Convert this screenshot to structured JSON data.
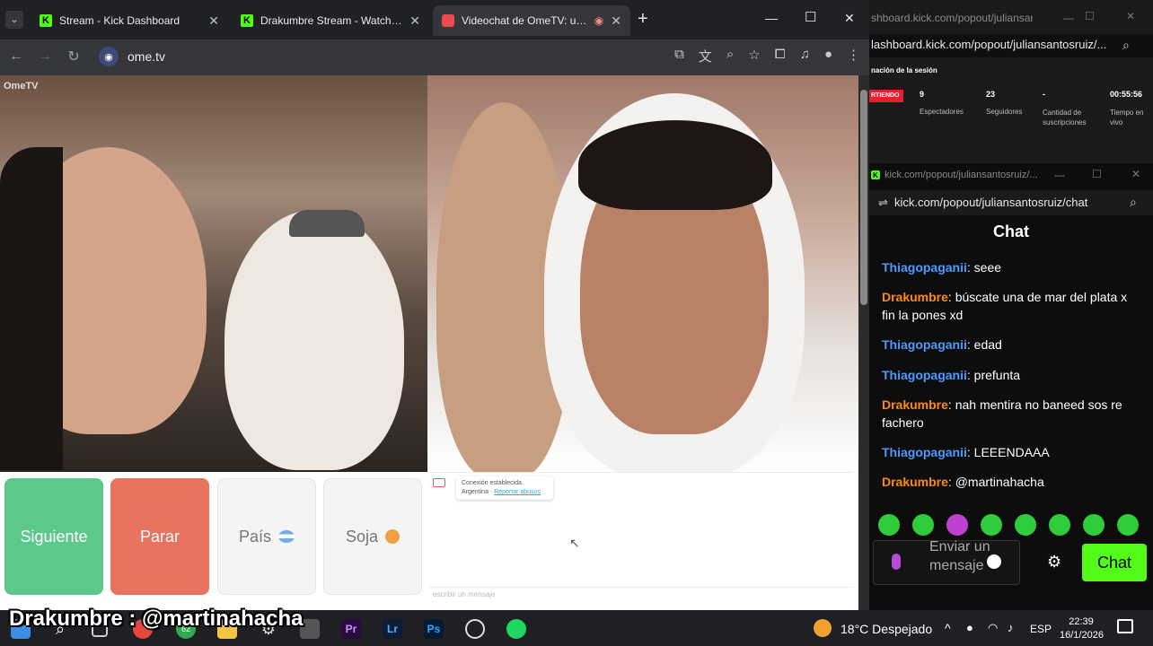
{
  "browser": {
    "tabs": [
      {
        "title": "Stream - Kick Dashboard"
      },
      {
        "title": "Drakumbre Stream - Watch Live"
      },
      {
        "title": "Videochat de OmeTV: una"
      }
    ],
    "new_tab": "+",
    "url": "ome.tv",
    "window_controls": {
      "minimize": "—",
      "maximize": "☐",
      "close": "✕"
    }
  },
  "ome": {
    "watermark": "OmeTV",
    "buttons": {
      "next": "Siguiente",
      "stop": "Parar",
      "country": "País",
      "gender": "Soja"
    },
    "connection": {
      "line1": "Conexión establecida.",
      "country": "Argentina",
      "report": "Reportar abusos"
    },
    "input_placeholder": "escribir un mensaje"
  },
  "kick_dashboard": {
    "window_title": "shboard.kick.com/popout/juliansan...",
    "url": "lashboard.kick.com/popout/juliansantosruiz/...",
    "section": "nación de la sesión",
    "live_badge": "RTIENDO",
    "stats": [
      {
        "value": "9",
        "label": "Espectadores"
      },
      {
        "value": "23",
        "label": "Seguidores"
      },
      {
        "value": "-",
        "label": "Cantidad de suscripciones"
      },
      {
        "value": "00:55:56",
        "label": "Tiempo en vivo"
      }
    ]
  },
  "kick_chat": {
    "window_title": "kick.com/popout/juliansantosruiz/...",
    "url": "kick.com/popout/juliansantosruiz/chat",
    "title": "Chat",
    "messages": [
      {
        "user": "Thiagopaganii",
        "text": ": seee"
      },
      {
        "user": "Drakumbre",
        "text": ": búscate una de mar del plata x fin la pones xd"
      },
      {
        "user": "Thiagopaganii",
        "text": ": edad"
      },
      {
        "user": "Thiagopaganii",
        "text": ": prefunta"
      },
      {
        "user": "Drakumbre",
        "text": ": nah mentira no baneed sos re fachero"
      },
      {
        "user": "Thiagopaganii",
        "text": ": LEEENDAAA"
      },
      {
        "user": "Drakumbre",
        "text": ": @martinahacha"
      }
    ],
    "input_placeholder": "Enviar un mensaje",
    "send_label": "Chat"
  },
  "overlay": {
    "text": "Drakumbre : @martinahacha"
  },
  "taskbar": {
    "badge": "62",
    "weather": "18°C  Despejado",
    "lang": "ESP",
    "time": "22:39",
    "date": "16/1/2026"
  },
  "colors": {
    "kick_green": "#53fc18",
    "next_green": "#5cc98a",
    "stop_red": "#e8735e"
  }
}
